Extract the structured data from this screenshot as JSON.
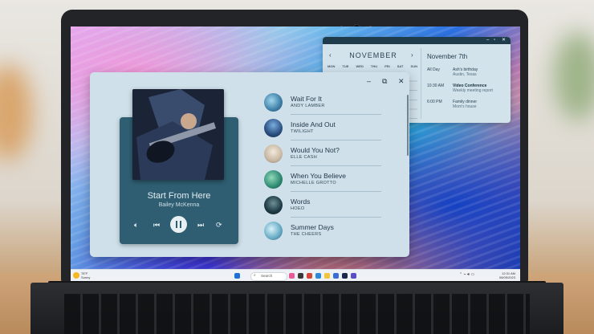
{
  "calendar": {
    "month": "NOVEMBER",
    "prev": "‹",
    "next": "›",
    "weekdays": [
      "MON",
      "TUE",
      "WED",
      "THU",
      "FRI",
      "SAT",
      "SUN"
    ],
    "selected_date": "November 7th",
    "events": [
      {
        "time": "All Day",
        "title": "Ash's birthday",
        "sub": "Austin, Texas",
        "bold": false
      },
      {
        "time": "10:30 AM",
        "title": "Video Conference",
        "sub": "Weekly meeting report",
        "bold": true
      },
      {
        "time": "6:00 PM",
        "title": "Family dinner",
        "sub": "Mom's house",
        "bold": false
      }
    ]
  },
  "player": {
    "now_playing": {
      "title": "Start From Here",
      "artist": "Bailey McKenna"
    },
    "tracks": [
      {
        "name": "Wait For It",
        "artist": "ANDY LAMBER",
        "color": "#3f7fa6"
      },
      {
        "name": "Inside And Out",
        "artist": "TWILIGHT",
        "color": "#2a4f80"
      },
      {
        "name": "Would You Not?",
        "artist": "ELLE CASH",
        "color": "#c9b8a4"
      },
      {
        "name": "When You Believe",
        "artist": "MICHELLE GROTTO",
        "color": "#2f8a73"
      },
      {
        "name": "Words",
        "artist": "HOEO",
        "color": "#1d3a44"
      },
      {
        "name": "Summer Days",
        "artist": "THE CHEERS",
        "color": "#6fb0c8"
      }
    ]
  },
  "taskbar": {
    "weather_temp": "78°F",
    "weather_desc": "Sunny",
    "search_label": "Search",
    "time": "12:31 AM",
    "date": "06/05/2023"
  },
  "colors": {
    "player_bg": "#cfe0ea",
    "card_bg": "#2f5e72",
    "calendar_bg": "#d3e3ec"
  }
}
